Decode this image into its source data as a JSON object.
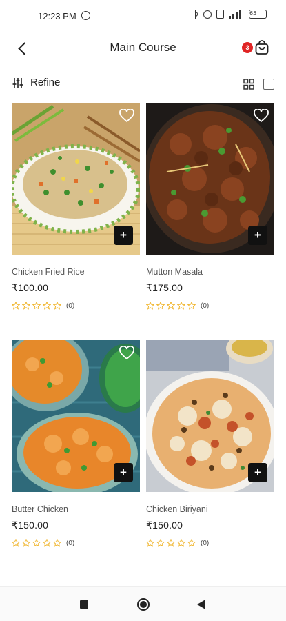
{
  "status_bar": {
    "time": "12:23 PM",
    "battery": "65"
  },
  "header": {
    "title": "Main Course",
    "cart_count": "3"
  },
  "toolbar": {
    "refine_label": "Refine"
  },
  "products": [
    {
      "name": "Chicken Fried Rice",
      "price": "₹100.00",
      "rating": 0,
      "rating_count": "(0)"
    },
    {
      "name": "Mutton Masala",
      "price": "₹175.00",
      "rating": 0,
      "rating_count": "(0)"
    },
    {
      "name": "Butter Chicken",
      "price": "₹150.00",
      "rating": 0,
      "rating_count": "(0)"
    },
    {
      "name": "Chicken Biriyani",
      "price": "₹150.00",
      "rating": 0,
      "rating_count": "(0)"
    }
  ],
  "colors": {
    "badge": "#e02424",
    "star": "#f0b429",
    "add_button": "#111111"
  },
  "icons": [
    "back-arrow-icon",
    "cart-icon",
    "refine-icon",
    "grid-view-icon",
    "list-view-icon",
    "heart-icon",
    "plus-icon",
    "star-icon"
  ]
}
